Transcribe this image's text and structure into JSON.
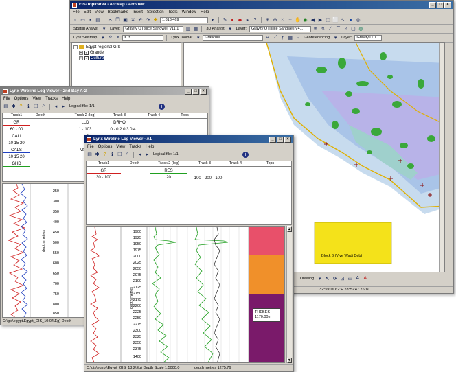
{
  "arcmap": {
    "title": "EIS-Topicarea - ArcMap - ArcView",
    "menu": [
      "File",
      "Edit",
      "View",
      "Bookmarks",
      "Insert",
      "Selection",
      "Tools",
      "Window",
      "Help"
    ],
    "scale": "1:813,469",
    "spatial_analyst": "Spatial Analyst",
    "layer_label": "Layer:",
    "layer_value_1": "Gravity OTislice Sandwell V11.1",
    "analyst_3d": "3D Analyst",
    "layer_value_2": "Gravity OTislice Sandwell V4...",
    "lynx_seismap": "Lynx Seismap",
    "seismap_combo": "K 3",
    "lynx_toolbar": "Lynx Toolbar",
    "gratcule": "Graticule",
    "georeferencing": "Georeferencing",
    "layer_value_3": "Gravity OTi",
    "toc": {
      "root": "Egypt regional GIS",
      "items": [
        "Grande",
        "Culture"
      ]
    },
    "drawing": "Drawing",
    "coords": "32°59'16.62\"E  28°52'47.76\"N",
    "map_label": "Block 6 (Vive Wadi Deb)"
  },
  "viewer1": {
    "title": "Lynx Wireline Log Viewer - 2nd Bay A-2",
    "menu": [
      "File",
      "Options",
      "View",
      "Tracks",
      "Help"
    ],
    "logical_file": "Logical file: 1/1",
    "headers": [
      "Track1",
      "Depth",
      "Track 2 (log)",
      "Track 3",
      "Track 4",
      "Tops"
    ],
    "curves": [
      "GR",
      "CALI",
      "CALS",
      "GHD"
    ],
    "ranges": [
      "60 · 00",
      "10 15 20",
      "10 15 20"
    ],
    "track2_vals": [
      "LLD",
      "1 · 103",
      "LLS",
      "MSFL"
    ],
    "track3_vals": [
      "DRHO",
      "0 · 0.2 0.3 0.4"
    ],
    "depth_axis": "depth metres",
    "depths": [
      "250",
      "300",
      "350",
      "400",
      "450",
      "500",
      "550",
      "600",
      "650",
      "700",
      "750",
      "800",
      "850"
    ],
    "status": "C:\\gis\\egypt\\Egypt_GIS_10:04\\Eg) Depth"
  },
  "viewer2": {
    "title": "Lynx Wireline Log Viewer - A1",
    "menu": [
      "File",
      "Options",
      "View",
      "Tracks",
      "Help"
    ],
    "logical_file": "Logical file: 1/1",
    "headers": [
      "Track1",
      "Depth",
      "Track 2 (log)",
      "Track 3",
      "Track 4",
      "Tops"
    ],
    "curve_gr": "GR",
    "gr_range": "30 · 100",
    "curve_res": "RES",
    "res_range": "20",
    "curve_3": "",
    "track3_range": "100 · 200 · 100",
    "depth_axis": "depth metres",
    "depths": [
      "1900",
      "1925",
      "1950",
      "1975",
      "2000",
      "2025",
      "2050",
      "2075",
      "2100",
      "2125",
      "2150",
      "2175",
      "2200",
      "2225",
      "2250",
      "2275",
      "2300",
      "2325",
      "2350",
      "2375",
      "1400"
    ],
    "tops_label": "THEBES 1170.00m",
    "status_file": "C:\\gis\\egypt\\Egypt_GIS_13.2\\Eg) Depth Scale 1:5000.0",
    "status_depth": "depth metres  1275.76",
    "tops_colors": {
      "top": "#e8506a",
      "mid": "#f0902a",
      "bottom": "#7a1a6a"
    }
  }
}
